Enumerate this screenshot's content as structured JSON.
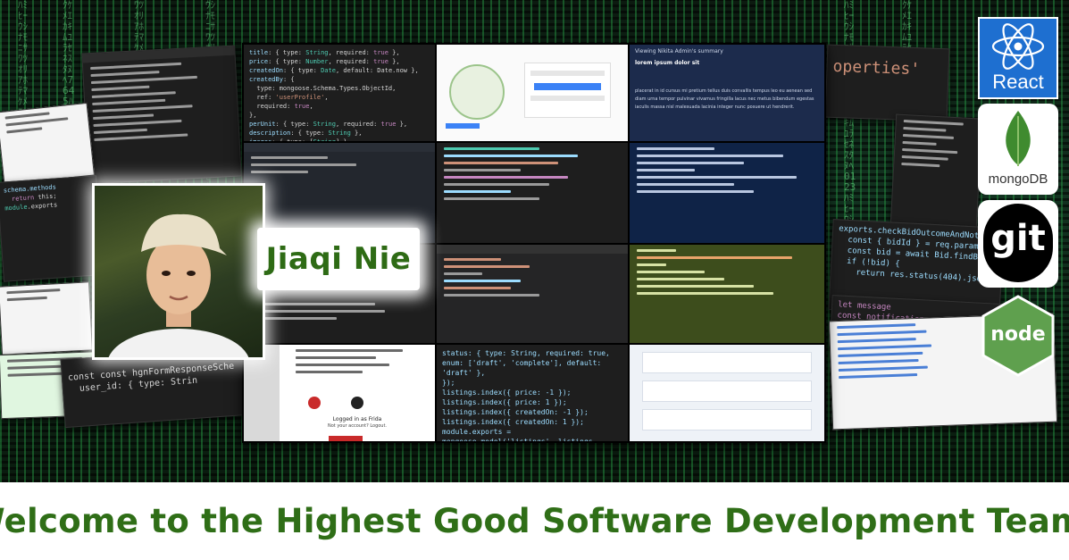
{
  "profile": {
    "name": "Jiaqi Nie"
  },
  "banner": {
    "text": "Welcome to the Highest Good Software Development Team!"
  },
  "logos": [
    {
      "icon": "react-icon",
      "label": "React",
      "color": "#1e6fd0"
    },
    {
      "icon": "mongodb-icon",
      "label": "mongoDB",
      "color": "#3f8b2f"
    },
    {
      "icon": "git-icon",
      "label": "git",
      "color": "#000000"
    },
    {
      "icon": "nodejs-icon",
      "label": "node",
      "color": "#5fa04e"
    }
  ],
  "screens": {
    "summary_header": "Viewing Nikita Admin's summary",
    "summary_title": "lorem ipsum dolor sit",
    "summary_body": "placerat in id cursus mi pretium tellus duis convallis tempus leo eu aenean sed diam urna tempor pulvinar vivamus fringilla lacus nec metus bibendum egestas iaculis massa nisl malesuada lacinia integer nunc posuere ut hendrerit.",
    "login_status": "Logged in as Frida",
    "login_switch": "Not your account? Logout.",
    "code_listing": "status: { type: String, required: true, enum: ['draft', 'complete'], default: 'draft' },\n});\nlistings.index({ price: -1 });\nlistings.index({ price: 1 });\nlistings.index({ createdOn: -1 });\nlistings.index({ createdOn: 1 });\nmodule.exports = mongoose.model('listings', listings, 'listings');",
    "properties_fragment": "operties'",
    "hgn_schema": "const hgnFormResponseSche",
    "hgn_user": "user_id: { type: Strin",
    "bid_code": "exports.checkBidOutcomeAndNotify\n  const { bidId } = req.params;\n  const bid = await Bid.findById\n  if (!bid) {\n    return res.status(404).json({ error: 'Bid not found'",
    "notify_code": "let message\nconst notification = new Notification(\n  user_id: bid.user_id.toString"
  }
}
